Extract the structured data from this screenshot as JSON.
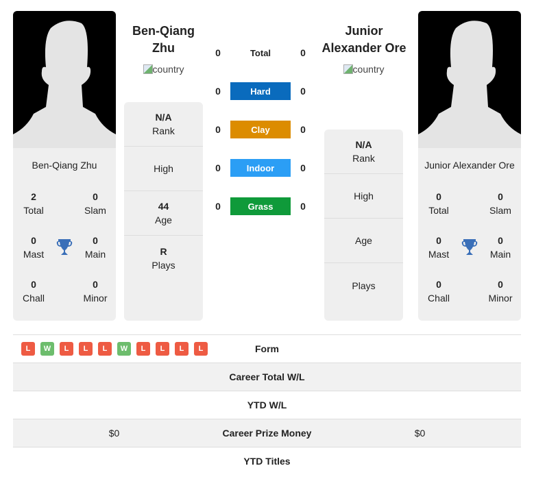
{
  "player1": {
    "name_title": "Ben-Qiang Zhu",
    "name": "Ben-Qiang Zhu",
    "flag_alt": "country",
    "stats": {
      "total": "2",
      "total_label": "Total",
      "slam": "0",
      "slam_label": "Slam",
      "mast": "0",
      "mast_label": "Mast",
      "main": "0",
      "main_label": "Main",
      "chall": "0",
      "chall_label": "Chall",
      "minor": "0",
      "minor_label": "Minor"
    },
    "info": {
      "rank_value": "N/A",
      "rank_label": "Rank",
      "high_label": "High",
      "age_value": "44",
      "age_label": "Age",
      "plays_value": "R",
      "plays_label": "Plays"
    },
    "form": [
      "L",
      "W",
      "L",
      "L",
      "L",
      "W",
      "L",
      "L",
      "L",
      "L"
    ],
    "prize_money": "$0"
  },
  "player2": {
    "name_title": "Junior Alexander Ore",
    "name": "Junior Alexander Ore",
    "flag_alt": "country",
    "stats": {
      "total": "0",
      "total_label": "Total",
      "slam": "0",
      "slam_label": "Slam",
      "mast": "0",
      "mast_label": "Mast",
      "main": "0",
      "main_label": "Main",
      "chall": "0",
      "chall_label": "Chall",
      "minor": "0",
      "minor_label": "Minor"
    },
    "info": {
      "rank_value": "N/A",
      "rank_label": "Rank",
      "high_label": "High",
      "age_label": "Age",
      "plays_label": "Plays"
    },
    "prize_money": "$0"
  },
  "surfaces": [
    {
      "label": "Total",
      "p1": "0",
      "p2": "0",
      "color": ""
    },
    {
      "label": "Hard",
      "p1": "0",
      "p2": "0",
      "color": "#0a6bbd"
    },
    {
      "label": "Clay",
      "p1": "0",
      "p2": "0",
      "color": "#dc8c00"
    },
    {
      "label": "Indoor",
      "p1": "0",
      "p2": "0",
      "color": "#2b9ef5"
    },
    {
      "label": "Grass",
      "p1": "0",
      "p2": "0",
      "color": "#0f9a3a"
    }
  ],
  "table": {
    "form_label": "Form",
    "career_wl_label": "Career Total W/L",
    "ytd_wl_label": "YTD W/L",
    "prize_label": "Career Prize Money",
    "ytd_titles_label": "YTD Titles"
  },
  "colors": {
    "win": "#6dbd6d",
    "loss": "#ee5b43",
    "trophy": "#3a6fb8"
  }
}
